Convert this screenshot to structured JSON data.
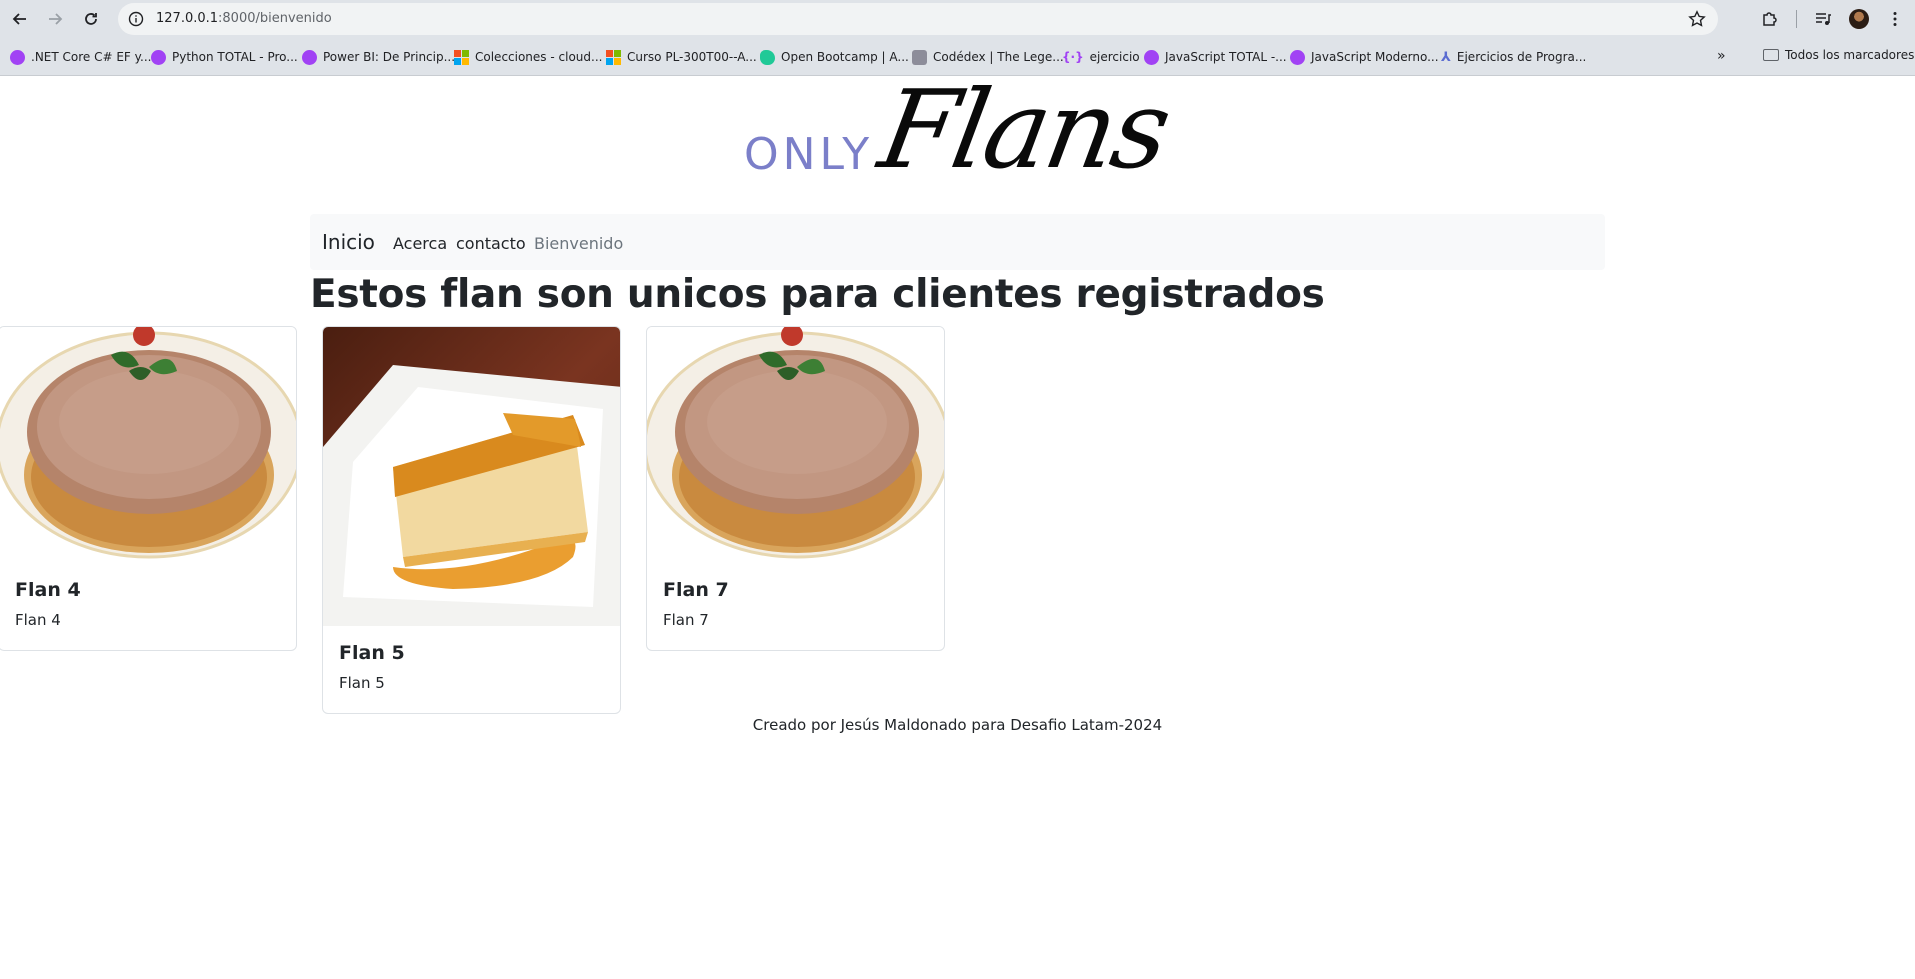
{
  "browser": {
    "url_host": "127.0.0.1",
    "url_path": ":8000/bienvenido",
    "bookmarks": [
      {
        "label": ".NET Core C# EF y...",
        "icon": "udemy-icon"
      },
      {
        "label": "Python TOTAL - Pro...",
        "icon": "udemy-icon"
      },
      {
        "label": "Power BI: De Princip...",
        "icon": "udemy-icon"
      },
      {
        "label": "Colecciones - cloud...",
        "icon": "microsoft-icon"
      },
      {
        "label": "Curso PL-300T00--A...",
        "icon": "microsoft-icon"
      },
      {
        "label": "Open Bootcamp | A...",
        "icon": "openbootcamp-icon"
      },
      {
        "label": "Codédex | The Lege...",
        "icon": "codedex-icon"
      },
      {
        "label": "ejercicio",
        "icon": "curly-braces-icon"
      },
      {
        "label": "JavaScript TOTAL -...",
        "icon": "udemy-icon"
      },
      {
        "label": "JavaScript Moderno...",
        "icon": "udemy-icon"
      },
      {
        "label": "Ejercicios de Progra...",
        "icon": "exercism-icon"
      }
    ],
    "all_bookmarks_label": "Todos los marcadores"
  },
  "logo": {
    "only": "ONLY",
    "flans": "Flans"
  },
  "nav": {
    "brand": "Inicio",
    "links": [
      "Acerca",
      "contacto",
      "Bienvenido"
    ]
  },
  "page": {
    "title": "Estos flan son unicos para clientes registrados"
  },
  "cards": [
    {
      "title": "Flan 4",
      "text": "Flan 4",
      "image": "flan-round-plate"
    },
    {
      "title": "Flan 5",
      "text": "Flan 5",
      "image": "flan-slice-square-plate"
    },
    {
      "title": "Flan 7",
      "text": "Flan 7",
      "image": "flan-round-plate"
    }
  ],
  "footer": {
    "text": "Creado por Jesús Maldonado para Desafio Latam-2024"
  },
  "colors": {
    "logo_only": "#7b7fc9",
    "navbar_bg": "#f8f9fa",
    "muted_link": "#6c757d"
  }
}
